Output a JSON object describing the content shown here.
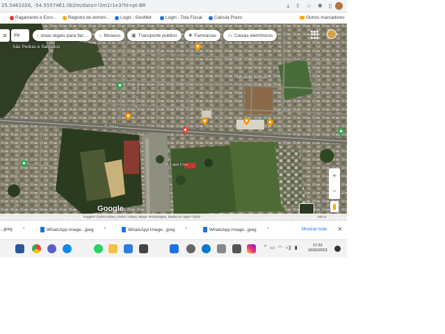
{
  "browser": {
    "url": "25.5461026, -54.5557461.0b2m/data=!3m1!1e3?hl=pt-BR",
    "bookmarks": [
      {
        "label": "Pagamento e Ecro...",
        "color": "#d93025"
      },
      {
        "label": "Registro de domini...",
        "color": "#f9ab00"
      },
      {
        "label": "Login - GeoMet",
        "color": "#1a73e8"
      },
      {
        "label": "Login - Tota Fiscal",
        "color": "#1a73e8"
      },
      {
        "label": "Calcula Prazo",
        "color": "#1a73e8"
      }
    ],
    "folder": "Outros marcadores",
    "icons": [
      "star-icon",
      "share-icon",
      "extensions-icon",
      "puzzle-icon",
      "window-icon"
    ]
  },
  "maps": {
    "search_text": "Pe",
    "chips": [
      {
        "label": "oisas legais para faz...",
        "icon": "‹"
      },
      {
        "label": "Museus",
        "icon": "⌂"
      },
      {
        "label": "Transporte público",
        "icon": "▣"
      },
      {
        "label": "Farmácias",
        "icon": "✚"
      },
      {
        "label": "Caixas eletrônicos",
        "icon": "▭"
      }
    ],
    "area_label": "São Pedras e Salgados",
    "street_labels": [
      "R. Lapa Cruz",
      "Almirante Barroso",
      "R. Maior",
      "R. Gen. Osório"
    ],
    "google": "Google",
    "attribution": "Imagens ©2023 Airbus, CNES / Airbus, Maxar Technologies, Dados do mapa ©2023",
    "scale": "100 m"
  },
  "downloads": {
    "items": [
      "...jpeg",
      "WhatsApp Image...jpeg",
      "WhatsApp Image...jpeg",
      "WhatsApp Image...jpeg"
    ],
    "show_all": "Mostrar tudo"
  },
  "taskbar": {
    "time": "17:32",
    "date": "16/02/2023",
    "apps": [
      "word-icon",
      "chrome-icon",
      "photos-icon",
      "edge-icon",
      "whatsapp-icon",
      "explorer-icon",
      "folder-icon",
      "calculator-icon",
      "download-icon",
      "instagram-icon"
    ]
  }
}
